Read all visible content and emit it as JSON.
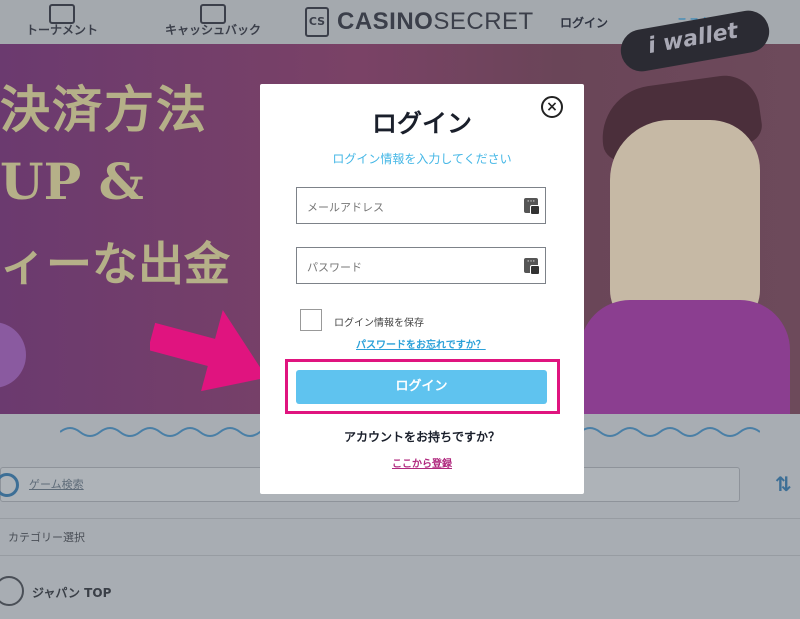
{
  "topnav": {
    "tournament_label": "トーナメント",
    "cashback_label": "キャッシュバック",
    "logo_bold": "CASINO",
    "logo_light": "SECRET",
    "logo_mark": "CS",
    "login_label": "ログイン",
    "register_label": "ここから登録"
  },
  "banner": {
    "line1": "決済方法",
    "line2": "UP &",
    "line3": "ィーな出金",
    "wallet_text": "i wallet"
  },
  "page": {
    "search_placeholder": "ゲーム検索",
    "category_label": "カテゴリー選択",
    "japan_label": "ジャパン TOP"
  },
  "modal": {
    "title": "ログイン",
    "subtitle": "ログイン情報を入力してください",
    "email_placeholder": "メールアドレス",
    "password_placeholder": "パスワード",
    "remember_label": "ログイン情報を保存",
    "forgot_link": "パスワードをお忘れですか？",
    "login_button": "ログイン",
    "no_account_text": "アカウントをお持ちですか？",
    "register_link": "ここから登録",
    "close_glyph": "×"
  },
  "colors": {
    "accent_blue": "#5fc3ef",
    "highlight_pink": "#e0147f",
    "link_magenta": "#b0287e"
  }
}
